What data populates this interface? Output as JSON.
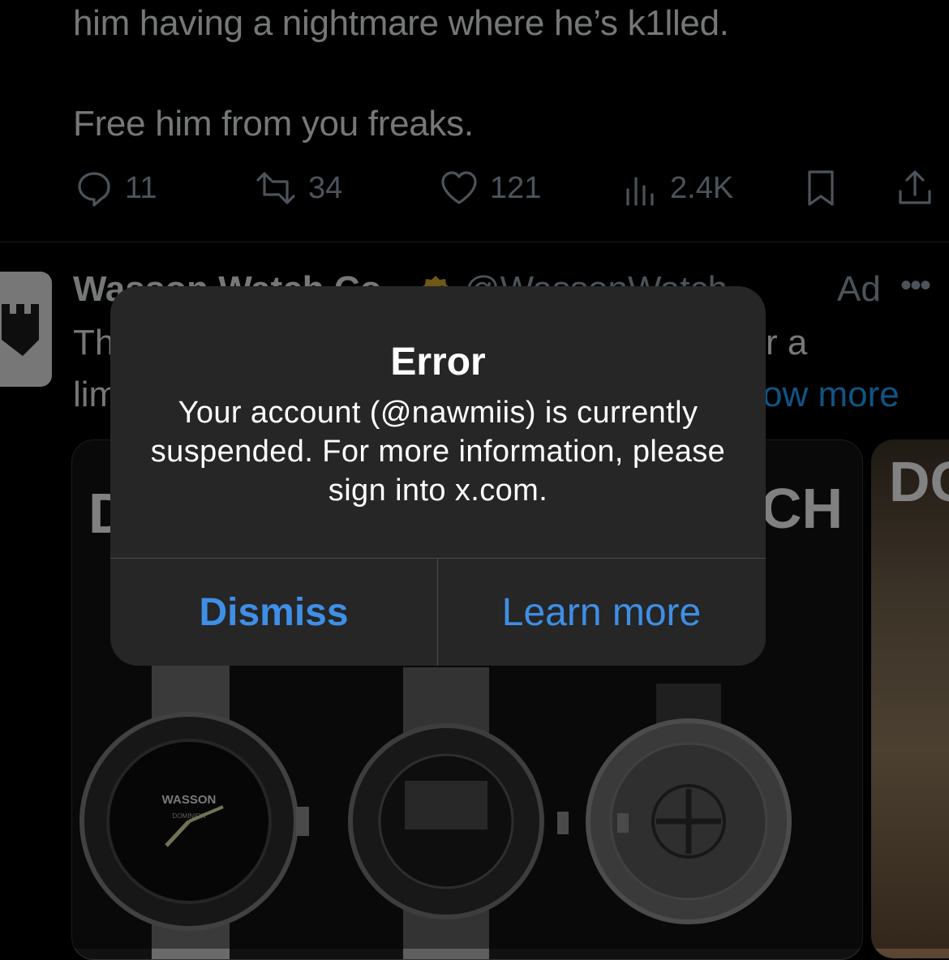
{
  "tweet": {
    "text_line1": "him having a nightmare where he’s k1lled.",
    "text_line2": "Free him from you freaks.",
    "replies": "11",
    "reposts": "34",
    "likes": "121",
    "views": "2.4K"
  },
  "ad": {
    "name": "Wasson Watch Co",
    "handle": "@WassonWatch",
    "label": "Ad",
    "line1_start": "Th",
    "line1_end": "r a",
    "line2_start": "lim",
    "show_more": "ow more",
    "card_title_left": "D",
    "card_title_right": "CH",
    "card2_title": "DC"
  },
  "watch": {
    "brand": "WASSON",
    "sub": "DOMINION"
  },
  "alert": {
    "title": "Error",
    "message": "Your account (@nawmiis) is currently suspended. For more information, please sign into x.com.",
    "dismiss_label": "Dismiss",
    "learn_more_label": "Learn more"
  },
  "colors": {
    "accent": "#3e8fe6",
    "link": "#1d9bf0",
    "verified_badge": "#c9a227"
  }
}
